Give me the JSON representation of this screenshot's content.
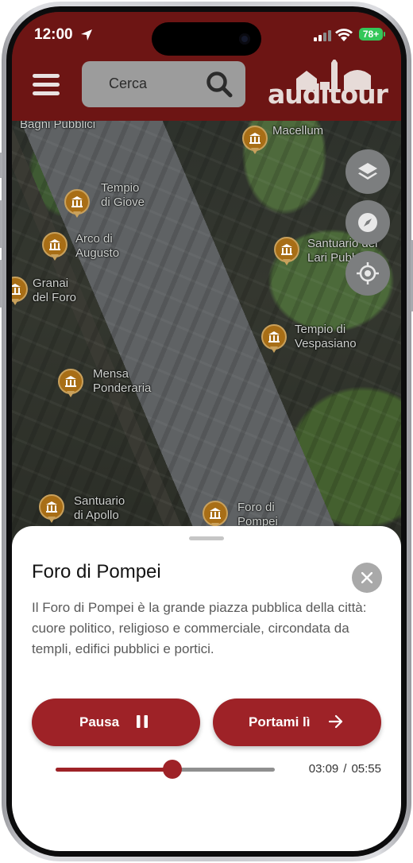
{
  "status_bar": {
    "time": "12:00",
    "battery": "78+"
  },
  "header": {
    "search_placeholder": "Cerca",
    "logo_text": "auditour",
    "brand_color": "#6d1514"
  },
  "map": {
    "pois": [
      {
        "label": "Bagni Pubblici"
      },
      {
        "label": "Macellum"
      },
      {
        "label": "Tempio\ndi Giove"
      },
      {
        "label": "Arco di\nAugusto"
      },
      {
        "label": "Santuario dei\nLari Pubblici"
      },
      {
        "label": "Granai\ndel Foro"
      },
      {
        "label": "Tempio di\nVespasiano"
      },
      {
        "label": "Mensa\nPonderaria"
      },
      {
        "label": "Santuario\ndi Apollo"
      },
      {
        "label": "Foro di\nPompei"
      }
    ],
    "controls": [
      "layers-icon",
      "compass-icon",
      "locate-icon"
    ]
  },
  "sheet": {
    "title": "Foro di Pompei",
    "description": "Il Foro di Pompei è la grande piazza pubblica della città: cuore politico, religioso e commerciale, circondata da templi, edifici pubblici e portici.",
    "pause_label": "Pausa",
    "go_label": "Portami lì",
    "accent_color": "#9e2227"
  },
  "player": {
    "current": "03:09",
    "total": "05:55",
    "separator": "/",
    "progress": 0.532
  }
}
